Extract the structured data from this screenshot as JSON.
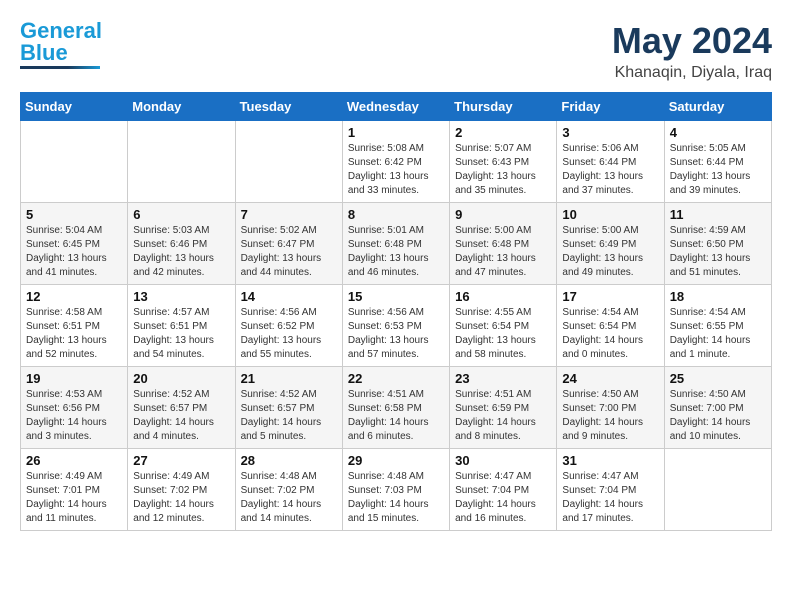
{
  "logo": {
    "general": "General",
    "blue": "Blue"
  },
  "header": {
    "month": "May 2024",
    "location": "Khanaqin, Diyala, Iraq"
  },
  "weekdays": [
    "Sunday",
    "Monday",
    "Tuesday",
    "Wednesday",
    "Thursday",
    "Friday",
    "Saturday"
  ],
  "weeks": [
    [
      {
        "day": "",
        "info": ""
      },
      {
        "day": "",
        "info": ""
      },
      {
        "day": "",
        "info": ""
      },
      {
        "day": "1",
        "info": "Sunrise: 5:08 AM\nSunset: 6:42 PM\nDaylight: 13 hours\nand 33 minutes."
      },
      {
        "day": "2",
        "info": "Sunrise: 5:07 AM\nSunset: 6:43 PM\nDaylight: 13 hours\nand 35 minutes."
      },
      {
        "day": "3",
        "info": "Sunrise: 5:06 AM\nSunset: 6:44 PM\nDaylight: 13 hours\nand 37 minutes."
      },
      {
        "day": "4",
        "info": "Sunrise: 5:05 AM\nSunset: 6:44 PM\nDaylight: 13 hours\nand 39 minutes."
      }
    ],
    [
      {
        "day": "5",
        "info": "Sunrise: 5:04 AM\nSunset: 6:45 PM\nDaylight: 13 hours\nand 41 minutes."
      },
      {
        "day": "6",
        "info": "Sunrise: 5:03 AM\nSunset: 6:46 PM\nDaylight: 13 hours\nand 42 minutes."
      },
      {
        "day": "7",
        "info": "Sunrise: 5:02 AM\nSunset: 6:47 PM\nDaylight: 13 hours\nand 44 minutes."
      },
      {
        "day": "8",
        "info": "Sunrise: 5:01 AM\nSunset: 6:48 PM\nDaylight: 13 hours\nand 46 minutes."
      },
      {
        "day": "9",
        "info": "Sunrise: 5:00 AM\nSunset: 6:48 PM\nDaylight: 13 hours\nand 47 minutes."
      },
      {
        "day": "10",
        "info": "Sunrise: 5:00 AM\nSunset: 6:49 PM\nDaylight: 13 hours\nand 49 minutes."
      },
      {
        "day": "11",
        "info": "Sunrise: 4:59 AM\nSunset: 6:50 PM\nDaylight: 13 hours\nand 51 minutes."
      }
    ],
    [
      {
        "day": "12",
        "info": "Sunrise: 4:58 AM\nSunset: 6:51 PM\nDaylight: 13 hours\nand 52 minutes."
      },
      {
        "day": "13",
        "info": "Sunrise: 4:57 AM\nSunset: 6:51 PM\nDaylight: 13 hours\nand 54 minutes."
      },
      {
        "day": "14",
        "info": "Sunrise: 4:56 AM\nSunset: 6:52 PM\nDaylight: 13 hours\nand 55 minutes."
      },
      {
        "day": "15",
        "info": "Sunrise: 4:56 AM\nSunset: 6:53 PM\nDaylight: 13 hours\nand 57 minutes."
      },
      {
        "day": "16",
        "info": "Sunrise: 4:55 AM\nSunset: 6:54 PM\nDaylight: 13 hours\nand 58 minutes."
      },
      {
        "day": "17",
        "info": "Sunrise: 4:54 AM\nSunset: 6:54 PM\nDaylight: 14 hours\nand 0 minutes."
      },
      {
        "day": "18",
        "info": "Sunrise: 4:54 AM\nSunset: 6:55 PM\nDaylight: 14 hours\nand 1 minute."
      }
    ],
    [
      {
        "day": "19",
        "info": "Sunrise: 4:53 AM\nSunset: 6:56 PM\nDaylight: 14 hours\nand 3 minutes."
      },
      {
        "day": "20",
        "info": "Sunrise: 4:52 AM\nSunset: 6:57 PM\nDaylight: 14 hours\nand 4 minutes."
      },
      {
        "day": "21",
        "info": "Sunrise: 4:52 AM\nSunset: 6:57 PM\nDaylight: 14 hours\nand 5 minutes."
      },
      {
        "day": "22",
        "info": "Sunrise: 4:51 AM\nSunset: 6:58 PM\nDaylight: 14 hours\nand 6 minutes."
      },
      {
        "day": "23",
        "info": "Sunrise: 4:51 AM\nSunset: 6:59 PM\nDaylight: 14 hours\nand 8 minutes."
      },
      {
        "day": "24",
        "info": "Sunrise: 4:50 AM\nSunset: 7:00 PM\nDaylight: 14 hours\nand 9 minutes."
      },
      {
        "day": "25",
        "info": "Sunrise: 4:50 AM\nSunset: 7:00 PM\nDaylight: 14 hours\nand 10 minutes."
      }
    ],
    [
      {
        "day": "26",
        "info": "Sunrise: 4:49 AM\nSunset: 7:01 PM\nDaylight: 14 hours\nand 11 minutes."
      },
      {
        "day": "27",
        "info": "Sunrise: 4:49 AM\nSunset: 7:02 PM\nDaylight: 14 hours\nand 12 minutes."
      },
      {
        "day": "28",
        "info": "Sunrise: 4:48 AM\nSunset: 7:02 PM\nDaylight: 14 hours\nand 14 minutes."
      },
      {
        "day": "29",
        "info": "Sunrise: 4:48 AM\nSunset: 7:03 PM\nDaylight: 14 hours\nand 15 minutes."
      },
      {
        "day": "30",
        "info": "Sunrise: 4:47 AM\nSunset: 7:04 PM\nDaylight: 14 hours\nand 16 minutes."
      },
      {
        "day": "31",
        "info": "Sunrise: 4:47 AM\nSunset: 7:04 PM\nDaylight: 14 hours\nand 17 minutes."
      },
      {
        "day": "",
        "info": ""
      }
    ]
  ]
}
